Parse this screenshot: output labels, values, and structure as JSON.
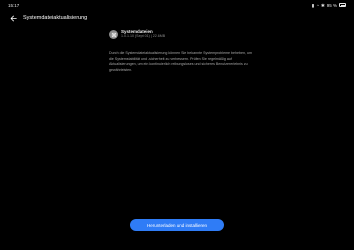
{
  "status_bar": {
    "time": "15:17",
    "battery_percent": "95 %",
    "icons": [
      "signal-icon",
      "wifi-icon",
      "bluetooth-icon",
      "battery-icon"
    ]
  },
  "header": {
    "back_icon": "back-arrow-icon",
    "title": "Systemdateiaktualisierung"
  },
  "update": {
    "icon": "update-icon",
    "title": "Systemdateien",
    "version": "1.0.1.10 (Sept 01) | 22.6MB",
    "description": "Durch die Systemdateiaktualisierung können Sie bekannte Systemprobleme beheben, um die Systemstabilität und -sicherheit zu verbessern. Prüfen Sie regelmäßig auf Aktualisierungen, um ein kontinuierlich reibungsloses und sicheres Benutzererlebnis zu gewährleisten."
  },
  "actions": {
    "download_install_label": "Herunterladen und installieren"
  },
  "colors": {
    "background": "#000000",
    "accent": "#2f7cf6"
  }
}
